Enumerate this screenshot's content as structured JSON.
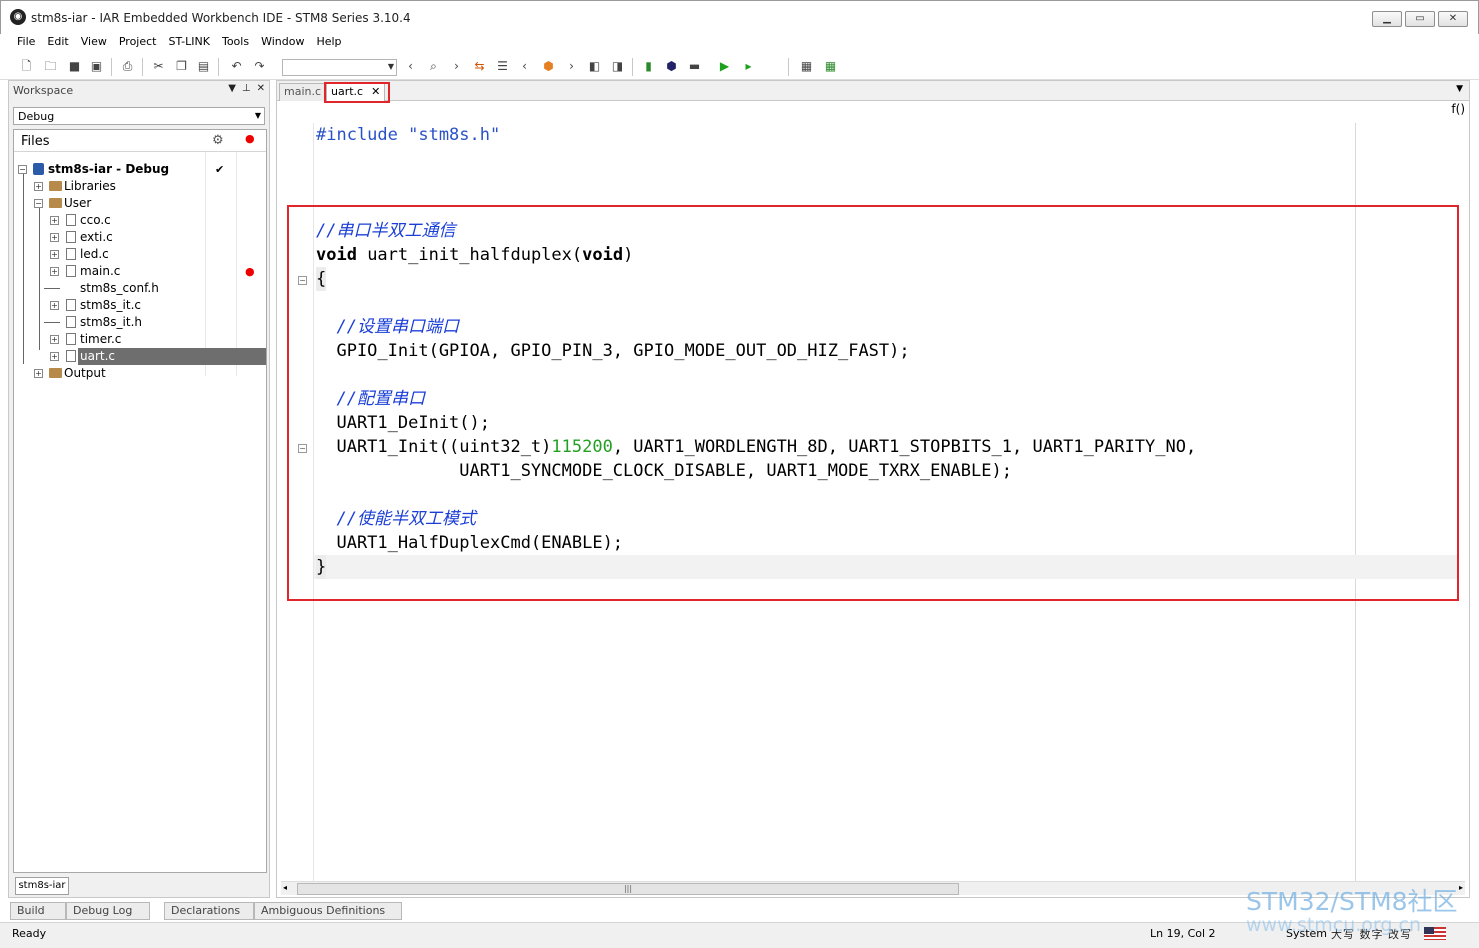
{
  "window": {
    "title": "stm8s-iar - IAR Embedded Workbench IDE - STM8 Series 3.10.4",
    "icon": "iar-app-icon",
    "buttons": [
      "minimize",
      "maximize",
      "close"
    ]
  },
  "menu": [
    "File",
    "Edit",
    "View",
    "Project",
    "ST-LINK",
    "Tools",
    "Window",
    "Help"
  ],
  "workspace": {
    "title": "Workspace",
    "config": "Debug",
    "files_header": "Files",
    "project": "stm8s-iar - Debug",
    "items": [
      {
        "label": "Libraries",
        "type": "folder"
      },
      {
        "label": "User",
        "type": "folder"
      },
      {
        "label": "cco.c",
        "type": "file"
      },
      {
        "label": "exti.c",
        "type": "file"
      },
      {
        "label": "led.c",
        "type": "file"
      },
      {
        "label": "main.c",
        "type": "file"
      },
      {
        "label": "stm8s_conf.h",
        "type": "file"
      },
      {
        "label": "stm8s_it.c",
        "type": "file"
      },
      {
        "label": "stm8s_it.h",
        "type": "file"
      },
      {
        "label": "timer.c",
        "type": "file"
      },
      {
        "label": "uart.c",
        "type": "file",
        "selected": true
      },
      {
        "label": "Output",
        "type": "folder"
      }
    ],
    "bottom_tab": "stm8s-iar"
  },
  "editor": {
    "tabs": [
      "main.c",
      "uart.c"
    ],
    "active_tab": "uart.c",
    "func_button": "f()",
    "code": {
      "l1": "#include \"stm8s.h\"",
      "l2": "//串口半双工通信",
      "l3a": "void",
      "l3b": " uart_init_halfduplex(",
      "l3c": "void",
      "l3d": ")",
      "l4": "{",
      "l5": "  //设置串口端口",
      "l6": "  GPIO_Init(GPIOA, GPIO_PIN_3, GPIO_MODE_OUT_OD_HIZ_FAST);",
      "l7": "  //配置串口",
      "l8": "  UART1_DeInit();",
      "l9a": "  UART1_Init((uint32_t)",
      "l9b": "115200",
      "l9c": ", UART1_WORDLENGTH_8D, UART1_STOPBITS_1, UART1_PARITY_NO,",
      "l10": "              UART1_SYNCMODE_CLOCK_DISABLE, UART1_MODE_TXRX_ENABLE);",
      "l11": "  //使能半双工模式",
      "l12": "  UART1_HalfDuplexCmd(ENABLE);",
      "l13": "}"
    },
    "colors": {
      "comment": "#1b3fd6",
      "number": "#23a023",
      "highlight": "#e0262a"
    }
  },
  "bottom_tabs": [
    "Build",
    "Debug Log",
    "Declarations",
    "Ambiguous Definitions"
  ],
  "status": {
    "left": "Ready",
    "position": "Ln 19, Col 2",
    "system": "System",
    "ime": "大写 数字 改写"
  },
  "watermark": {
    "line1": "STM32/STM8社区",
    "line2": "www.stmcu.org.cn"
  }
}
